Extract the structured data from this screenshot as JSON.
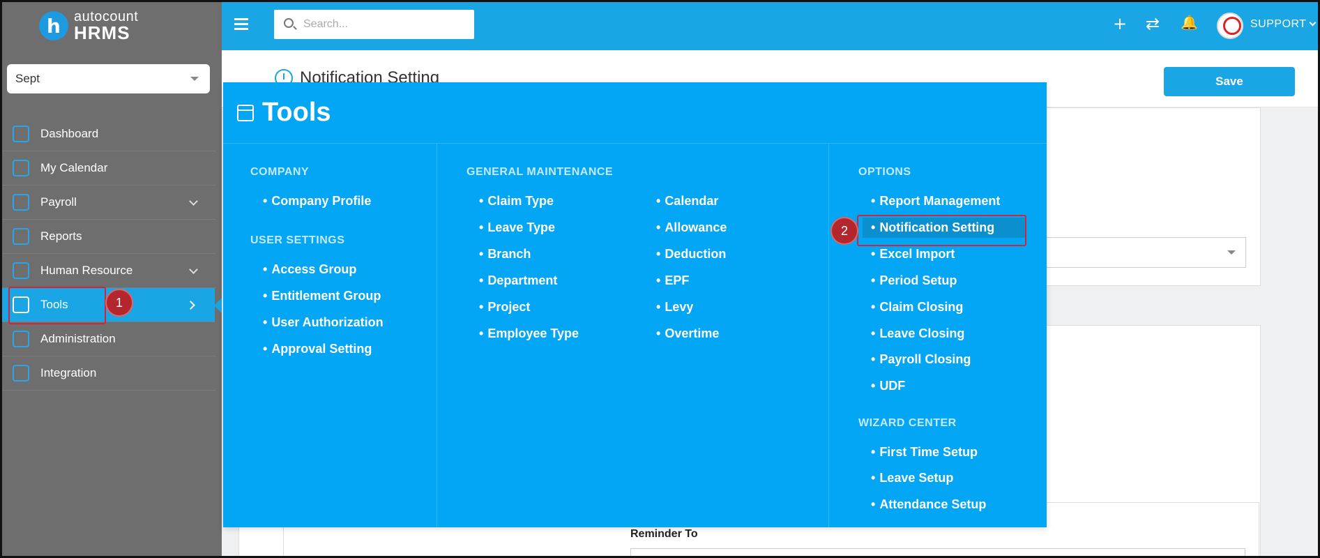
{
  "brand": {
    "top": "autocount",
    "bottom": "HRMS",
    "mark": "h"
  },
  "sidebar": {
    "period": "Sept",
    "items": [
      {
        "label": "Dashboard",
        "icon": "dashboard-icon"
      },
      {
        "label": "My Calendar",
        "icon": "calendar-icon"
      },
      {
        "label": "Payroll",
        "icon": "payroll-icon"
      },
      {
        "label": "Reports",
        "icon": "reports-icon"
      },
      {
        "label": "Human Resource",
        "icon": "human-resource-icon"
      },
      {
        "label": "Tools",
        "icon": "tools-icon"
      },
      {
        "label": "Administration",
        "icon": "administration-icon"
      },
      {
        "label": "Integration",
        "icon": "integration-icon"
      }
    ]
  },
  "topbar": {
    "search_placeholder": "Search...",
    "plus": "+",
    "sync": "⇄",
    "bell": "🔔",
    "user": "SUPPORT"
  },
  "page": {
    "title": "Notification Setting",
    "save_label": "Save",
    "reminder_to_label": "Reminder To"
  },
  "mega_menu": {
    "title": "Tools",
    "company": {
      "title": "COMPANY",
      "items": [
        "Company Profile"
      ]
    },
    "user_settings": {
      "title": "USER SETTINGS",
      "items": [
        "Access Group",
        "Entitlement Group",
        "User Authorization",
        "Approval Setting"
      ]
    },
    "general_maintenance": {
      "title": "GENERAL MAINTENANCE",
      "col_a": [
        "Claim Type",
        "Leave Type",
        "Branch",
        "Department",
        "Project",
        "Employee Type"
      ],
      "col_b": [
        "Calendar",
        "Allowance",
        "Deduction",
        "EPF",
        "Levy",
        "Overtime"
      ]
    },
    "options": {
      "title": "OPTIONS",
      "items": [
        "Report Management",
        "Notification Setting",
        "Excel Import",
        "Period Setup",
        "Claim Closing",
        "Leave Closing",
        "Payroll Closing",
        "UDF"
      ]
    },
    "wizard_center": {
      "title": "WIZARD CENTER",
      "items": [
        "First Time Setup",
        "Leave Setup",
        "Attendance Setup"
      ]
    }
  },
  "annotations": {
    "step1": "1",
    "step2": "2"
  },
  "colors": {
    "accent": "#1aa6e4",
    "menu_bg": "#03a6f4",
    "sidebar_bg": "#6e6e6e",
    "marker": "#b3262e"
  }
}
